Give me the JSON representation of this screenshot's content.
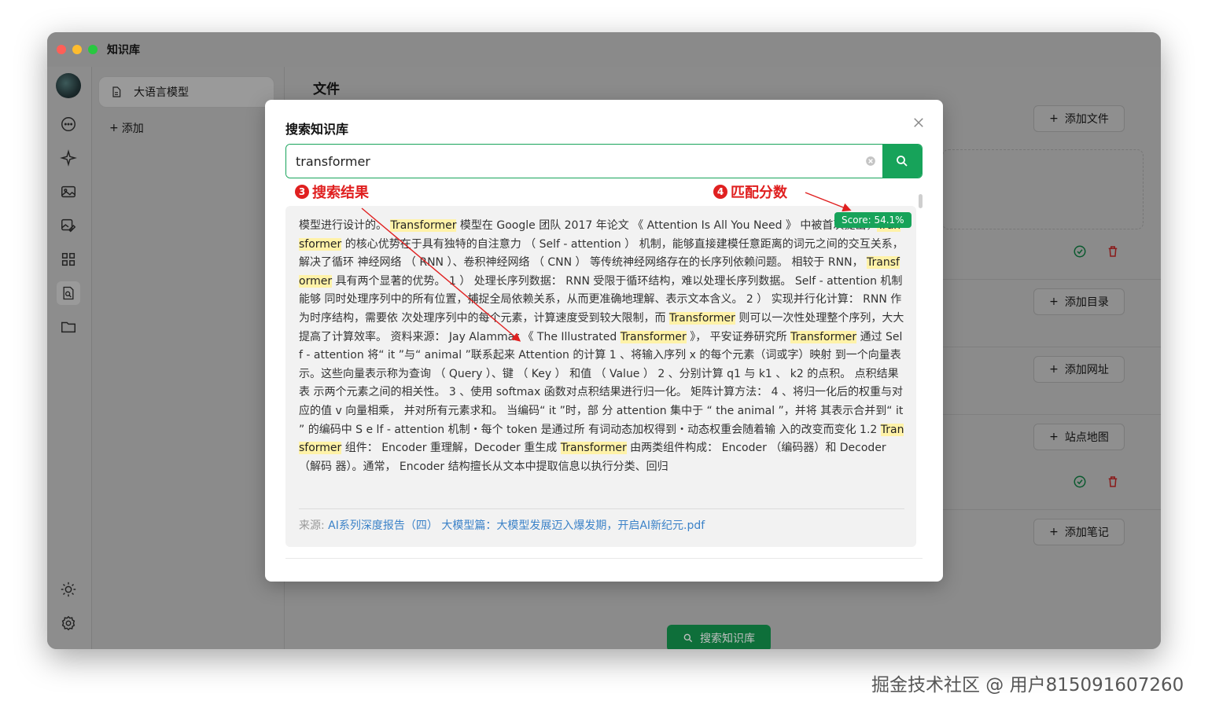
{
  "window": {
    "title": "知识库"
  },
  "knowledge_base": {
    "item_label": "大语言模型",
    "add_label": "添加"
  },
  "main": {
    "title": "文件",
    "buttons": {
      "add_file": "添加文件",
      "add_directory": "添加目录",
      "add_url": "添加网址",
      "sitemap": "站点地图",
      "add_note": "添加笔记"
    },
    "search_button": "搜索知识库"
  },
  "modal": {
    "title": "搜索知识库",
    "search_value": "transformer",
    "annotation_results": "搜索结果",
    "annotation_results_num": "3",
    "annotation_score": "匹配分数",
    "annotation_score_num": "4",
    "score": "Score: 54.1%",
    "result_segments": [
      {
        "t": "模型进行设计的。 ",
        "h": false
      },
      {
        "t": "Transformer",
        "h": true
      },
      {
        "t": " 模型在 Google 团队 2017 年论文 《 Attention Is All You Need 》 中被首次提出，",
        "h": false
      },
      {
        "t": "Transformer",
        "h": true
      },
      {
        "t": " 的核心优势在于具有独特的自注意力 （ Self - attention ） 机制，能够直接建模任意距离的词元之间的交互关系，解决了循环 神经网络 （ RNN ）、卷积神经网络 （ CNN ） 等传统神经网络存在的长序列依赖问题。 相较于 RNN， ",
        "h": false
      },
      {
        "t": "Transformer",
        "h": true
      },
      {
        "t": " 具有两个显著的优势。 1 ） 处理长序列数据： RNN 受限于循环结构，难以处理长序列数据。 Self - attention 机制能够 同时处理序列中的所有位置，捕捉全局依赖关系，从而更准确地理解、表示文本含义。 2 ） 实现并行化计算： RNN 作为时序结构，需要依 次处理序列中的每个元素，计算速度受到较大限制，而 ",
        "h": false
      },
      {
        "t": "Transformer",
        "h": true
      },
      {
        "t": " 则可以一次性处理整个序列，大大提高了计算效率。 资料来源： Jay Alammar 《 The Illustrated ",
        "h": false
      },
      {
        "t": "Transformer",
        "h": true
      },
      {
        "t": " 》， 平安证券研究所 ",
        "h": false
      },
      {
        "t": "Transformer",
        "h": true
      },
      {
        "t": " 通过 Self - attention 将“ it ”与“ animal ”联系起来 Attention 的计算 1 、将输入序列 x 的每个元素（词或字）映射 到一个向量表示。这些向量表示称为查询 （ Query ）、键 （ Key ） 和值 （ Value ） 2 、分别计算 q1 与 k1 、 k2 的点积。 点积结果表 示两个元素之间的相关性。 3 、使用 softmax 函数对点积结果进行归一化。 矩阵计算方法： 4 、将归一化后的权重与对应的值 v 向量相乘， 并对所有元素求和。 当编码“ it ”时，部 分 attention 集中于 “ the animal ”，并将 其表示合并到“ it ” 的编码中 S e lf - attention 机制・每个 token 是通过所 有词动态加权得到・动态权重会随着输 入的改变而变化 1.2 ",
        "h": false
      },
      {
        "t": "Transformer",
        "h": true
      },
      {
        "t": " 组件： Encoder 重理解，Decoder 重生成 ",
        "h": false
      },
      {
        "t": "Transformer",
        "h": true
      },
      {
        "t": " 由两类组件构成： Encoder （编码器）和 Decoder （解码 器）。通常， Encoder 结构擅长从文本中提取信息以执行分类、回归",
        "h": false
      }
    ],
    "source_label": "来源: ",
    "source_link": "AI系列深度报告（四） 大模型篇：大模型发展迈入爆发期，开启AI新纪元.pdf"
  },
  "watermark": "掘金技术社区 @ 用户815091607260",
  "colors": {
    "accent": "#17a35a",
    "annotation": "#e02020",
    "highlight": "#fff2a8",
    "overlay": "#8b8b8b"
  }
}
